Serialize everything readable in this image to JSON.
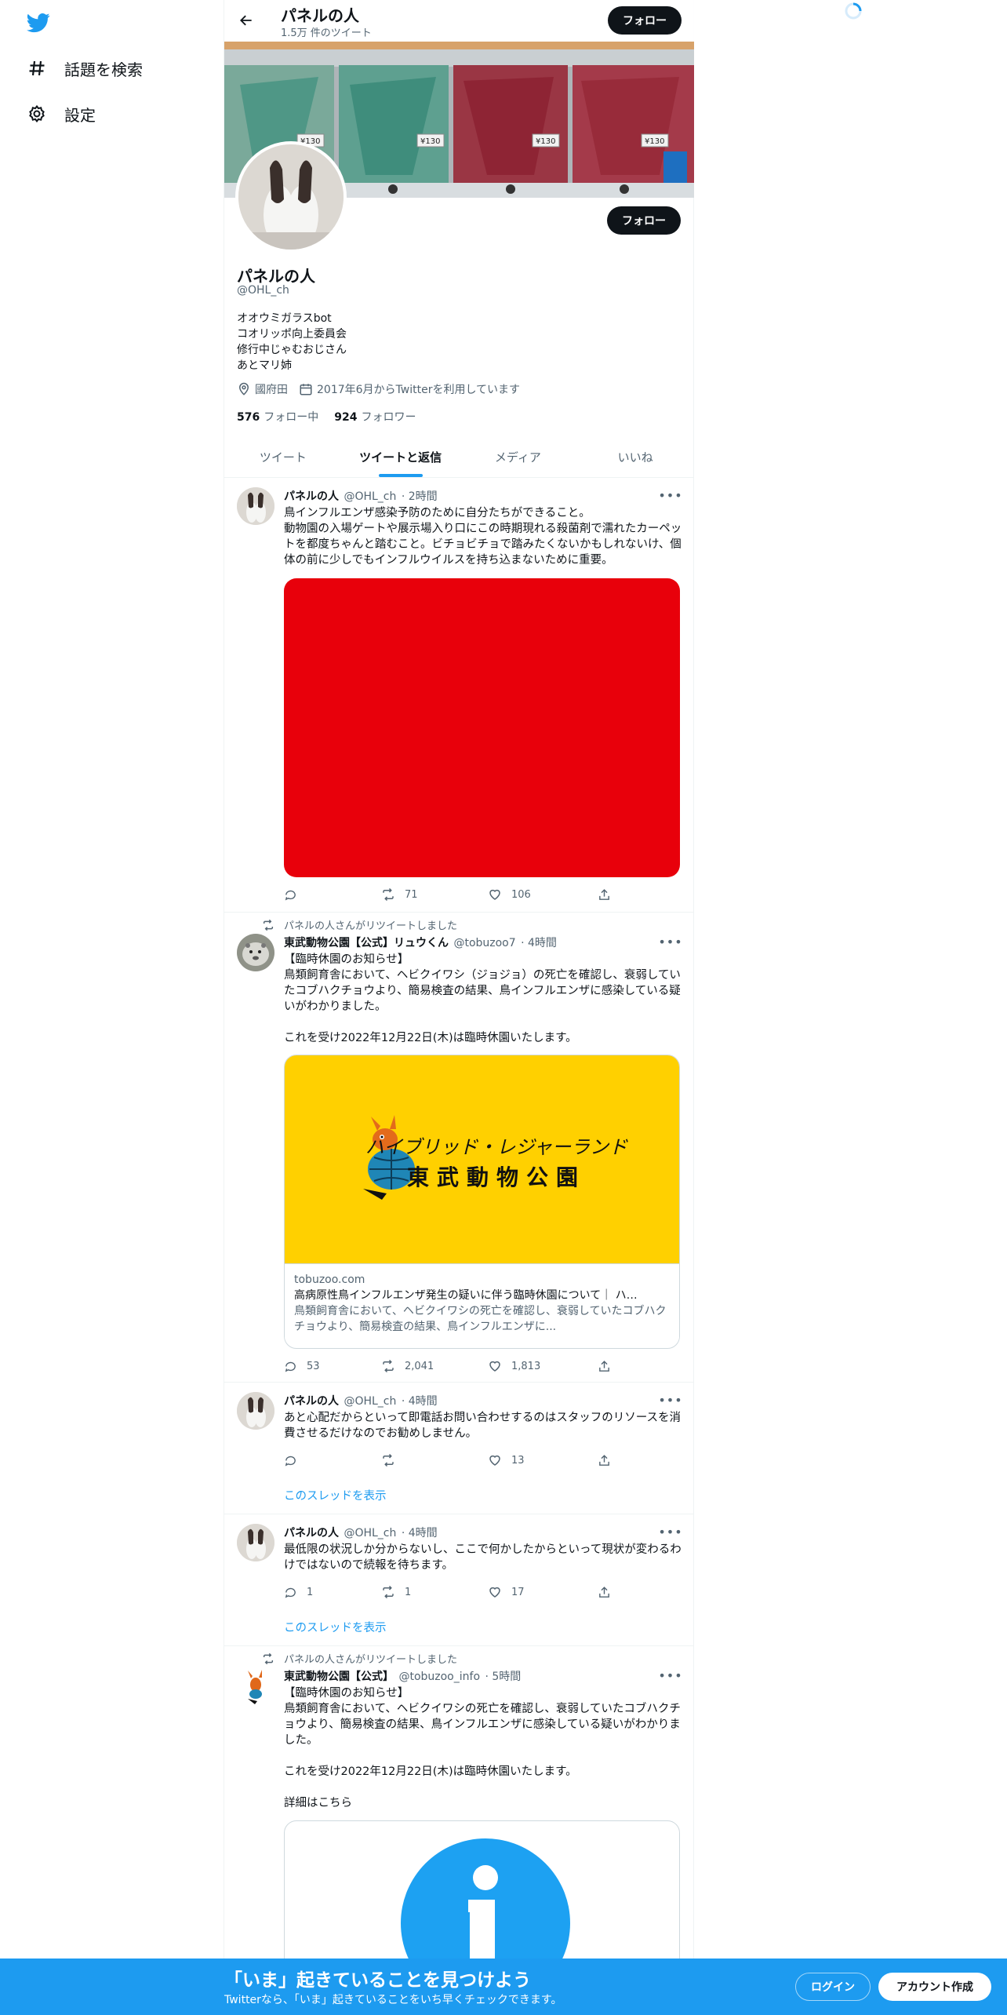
{
  "colors": {
    "accent": "#1d9bf0",
    "text": "#0f1419",
    "muted": "#536471",
    "red_media": "#e8000b",
    "card_yellow": "#ffd000"
  },
  "nav": {
    "items": [
      {
        "icon": "hashtag-icon",
        "label": "話題を検索"
      },
      {
        "icon": "gear-icon",
        "label": "設定"
      }
    ]
  },
  "header": {
    "title": "パネルの人",
    "subtitle": "1.5万 件のツイート",
    "follow_label": "フォロー"
  },
  "banner": {
    "price_tags": [
      "¥130",
      "¥130",
      "¥130",
      "¥130"
    ]
  },
  "profile": {
    "name": "パネルの人",
    "handle": "@OHL_ch",
    "follow_label": "フォロー",
    "bio": "オオウミガラスbot\nコオリッポ向上委員会\n修行中じゃむおじさん\nあとマリ姉",
    "location": "國府田",
    "joined": "2017年6月からTwitterを利用しています",
    "following_count": "576",
    "following_label": "フォロー中",
    "followers_count": "924",
    "followers_label": "フォロワー"
  },
  "tabs": [
    "ツイート",
    "ツイートと返信",
    "メディア",
    "いいね"
  ],
  "tweets": [
    {
      "name": "パネルの人",
      "handle": "@OHL_ch",
      "time": "· 2時間",
      "text": "鳥インフルエンザ感染予防のために自分たちができること。\n動物園の入場ゲートや展示場入り口にこの時期現れる殺菌剤で濡れたカーペットを都度ちゃんと踏むこと。ビチョビチョで踏みたくないかもしれないけ、個体の前に少しでもインフルウイルスを持ち込まないために重要。",
      "reply": "",
      "retweet": "71",
      "like": "106"
    },
    {
      "retweeted_by": "パネルの人さんがリツイートしました",
      "name": "東武動物公園【公式】リュウくん",
      "handle": "@tobuzoo7",
      "time": "· 4時間",
      "text": "【臨時休園のお知らせ】\n鳥類飼育舎において、ヘビクイワシ（ジョジョ）の死亡を確認し、衰弱していたコブハクチョウより、簡易検査の結果、鳥インフルエンザに感染している疑いがわかりました。\n\nこれを受け2022年12月22日(木)は臨時休園いたします。",
      "card": {
        "logo_line1": "ハイブリッド・レジャーランド",
        "logo_line2": "東武動物公園",
        "domain": "tobuzoo.com",
        "title": "高病原性鳥インフルエンザ発生の疑いに伴う臨時休園について｜ ハ…",
        "desc": "鳥類飼育舎において、ヘビクイワシの死亡を確認し、衰弱していたコブハクチョウより、簡易検査の結果、鳥インフルエンザに..."
      },
      "reply": "53",
      "retweet": "2,041",
      "like": "1,813"
    },
    {
      "name": "パネルの人",
      "handle": "@OHL_ch",
      "time": "· 4時間",
      "text": "あと心配だからといって即電話お問い合わせするのはスタッフのリソースを消費させるだけなのでお勧めしません。",
      "reply": "",
      "retweet": "",
      "like": "13",
      "thread": "このスレッドを表示"
    },
    {
      "name": "パネルの人",
      "handle": "@OHL_ch",
      "time": "· 4時間",
      "text": "最低限の状況しか分からないし、ここで何かしたからといって現状が変わるわけではないので続報を待ちます。",
      "reply": "1",
      "retweet": "1",
      "like": "17",
      "thread": "このスレッドを表示"
    },
    {
      "retweeted_by": "パネルの人さんがリツイートしました",
      "name": "東武動物公園【公式】",
      "handle": "@tobuzoo_info",
      "time": "· 5時間",
      "text": "【臨時休園のお知らせ】\n鳥類飼育舎において、ヘビクイワシの死亡を確認し、衰弱していたコブハクチョウより、簡易検査の結果、鳥インフルエンザに感染している疑いがわかりました。\n\nこれを受け2022年12月22日(木)は臨時休園いたします。\n\n詳細はこちら"
    }
  ],
  "bottom": {
    "headline": "「いま」起きていることを見つけよう",
    "sub": "Twitterなら、「いま」起きていることをいち早くチェックできます。",
    "login": "ログイン",
    "signup": "アカウント作成"
  }
}
